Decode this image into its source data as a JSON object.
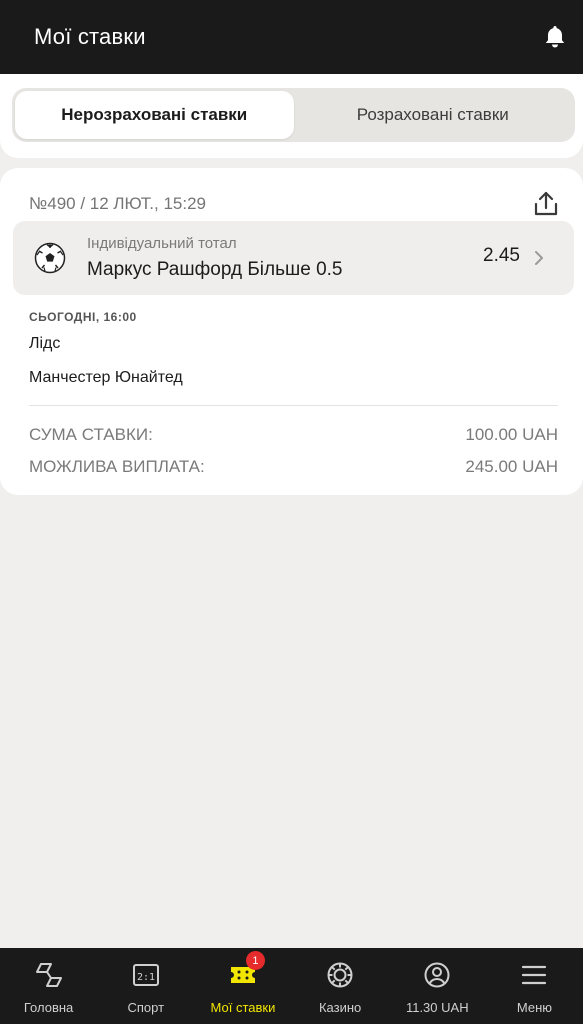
{
  "header": {
    "title": "Мої ставки",
    "notification_icon": "bell-icon"
  },
  "tabs": [
    {
      "label": "Нерозраховані ставки",
      "active": true
    },
    {
      "label": "Розраховані ставки",
      "active": false
    }
  ],
  "bet": {
    "id_date": "№490 / 12 ЛЮТ., 15:29",
    "share_icon": "share-icon",
    "selection": {
      "sport_icon": "soccer-ball-icon",
      "market": "Індивідуальний тотал",
      "pick": "Маркус Рашфорд Більше 0.5",
      "odds": "2.45"
    },
    "match_time": "СЬОГОДНІ, 16:00",
    "team_home": "Лідс",
    "team_away": "Манчестер Юнайтед",
    "stake_label": "СУМА СТАВКИ:",
    "stake_value": "100.00 UAH",
    "payout_label": "МОЖЛИВА ВИПЛАТА:",
    "payout_value": "245.00 UAH"
  },
  "nav": [
    {
      "label": "Головна",
      "icon": "home-icon",
      "active": false
    },
    {
      "label": "Спорт",
      "icon": "scoreboard-icon",
      "active": false
    },
    {
      "label": "Мої ставки",
      "icon": "ticket-icon",
      "active": true,
      "badge": "1"
    },
    {
      "label": "Казино",
      "icon": "casino-chip-icon",
      "active": false
    },
    {
      "label": "11.30 UAH",
      "icon": "user-icon",
      "active": false
    },
    {
      "label": "Меню",
      "icon": "menu-icon",
      "active": false
    }
  ],
  "colors": {
    "header_bg": "#1a1a1a",
    "accent_yellow": "#f2e600",
    "badge_red": "#e52b2b"
  }
}
